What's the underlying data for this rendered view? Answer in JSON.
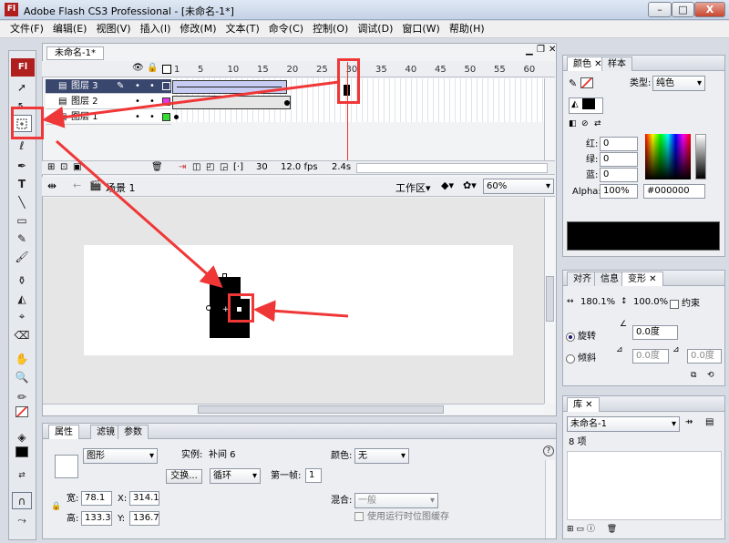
{
  "window": {
    "title": "Adobe Flash CS3 Professional - [未命名-1*]",
    "app_icon": "Fl",
    "minimize": "–",
    "maximize": "□",
    "close": "X"
  },
  "menubar": {
    "items": [
      "文件(F)",
      "编辑(E)",
      "视图(V)",
      "插入(I)",
      "修改(M)",
      "文本(T)",
      "命令(C)",
      "控制(O)",
      "调试(D)",
      "窗口(W)",
      "帮助(H)"
    ]
  },
  "document": {
    "tab_label": "未命名-1*"
  },
  "timeline": {
    "frame_numbers": [
      "1",
      "5",
      "10",
      "15",
      "20",
      "25",
      "30",
      "35",
      "40",
      "45",
      "50",
      "55",
      "60"
    ],
    "layers": [
      {
        "name": "图层 3",
        "selected": true
      },
      {
        "name": "图层 2",
        "selected": false
      },
      {
        "name": "图层 1",
        "selected": false
      }
    ],
    "current_frame": "30",
    "fps": "12.0 fps",
    "time": "2.4s"
  },
  "editbar": {
    "scene": "场景 1",
    "workspace": "工作区",
    "zoom": "60%"
  },
  "properties": {
    "tabs": [
      "属性",
      "滤镜",
      "参数"
    ],
    "symbol_type": "图形",
    "instance_label": "实例:",
    "instance_name": "补间 6",
    "swap_button": "交换...",
    "loop_mode": "循环",
    "first_frame_label": "第一帧:",
    "first_frame": "1",
    "color_label": "颜色:",
    "color_value": "无",
    "blend_label": "混合:",
    "blend_value": "一般",
    "cache_label": "使用运行时位图缓存",
    "width_label": "宽:",
    "width": "78.1",
    "height_label": "高:",
    "height": "133.3",
    "x_label": "X:",
    "x": "314.1",
    "y_label": "Y:",
    "y": "136.7"
  },
  "color_panel": {
    "tabs": [
      "颜色",
      "样本"
    ],
    "type_label": "类型:",
    "type_value": "纯色",
    "red_label": "红:",
    "red": "0",
    "green_label": "绿:",
    "green": "0",
    "blue_label": "蓝:",
    "blue": "0",
    "alpha_label": "Alpha:",
    "alpha": "100%",
    "hex": "#000000"
  },
  "transform_panel": {
    "tabs": [
      "对齐",
      "信息",
      "变形"
    ],
    "scale_w": "180.1%",
    "scale_h": "100.0%",
    "constrain_label": "约束",
    "rotate_label": "旋转",
    "rotate_value": "0.0度",
    "skew_label": "倾斜",
    "skew_h": "0.0度",
    "skew_v": "0.0度"
  },
  "library_panel": {
    "tab": "库",
    "document": "未命名-1",
    "item_count": "8 项"
  },
  "colors": {
    "highlight": "#f03737",
    "keyframe_span": "#c7cdf2",
    "stage_bg": "#ffffff",
    "pasteboard": "#e6e6e6"
  }
}
